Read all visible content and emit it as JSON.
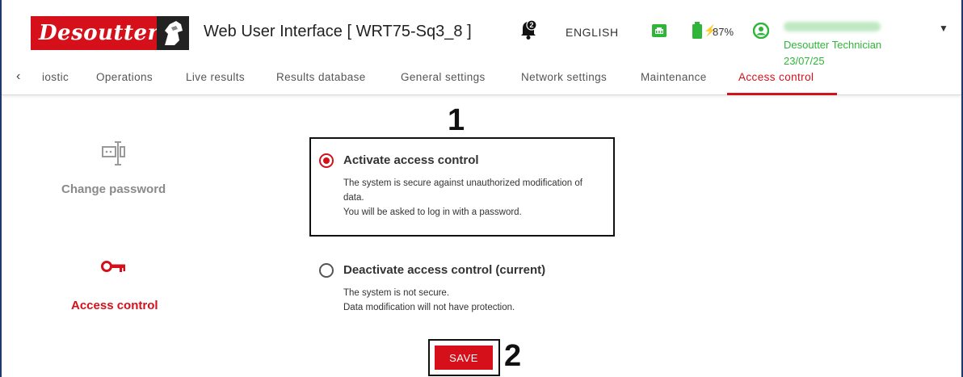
{
  "header": {
    "brand": "Desoutter",
    "app_title": "Web User Interface [ WRT75-Sq3_8 ]",
    "notification_count": "2",
    "language": "ENGLISH",
    "battery_percent": "87%",
    "user_role": "Desoutter Technician",
    "user_date": "23/07/25"
  },
  "tabs": [
    {
      "label": "iostic"
    },
    {
      "label": "Operations"
    },
    {
      "label": "Live results"
    },
    {
      "label": "Results database"
    },
    {
      "label": "General settings"
    },
    {
      "label": "Network settings"
    },
    {
      "label": "Maintenance"
    },
    {
      "label": "Access control",
      "active": true
    }
  ],
  "side_menu": {
    "change_password": "Change password",
    "access_control": "Access control"
  },
  "options": {
    "activate": {
      "title": "Activate access control",
      "desc_line1": "The system is secure against unauthorized modification of",
      "desc_line2": "data.",
      "desc_line3": "You will be asked to log in with a password.",
      "selected": true
    },
    "deactivate": {
      "title": "Deactivate access control (current)",
      "desc_line1": "The system is not secure.",
      "desc_line2": "Data modification will not have protection.",
      "selected": false
    }
  },
  "save_label": "SAVE",
  "annotations": {
    "first": "1",
    "second": "2"
  },
  "colors": {
    "brand_red": "#d6101b",
    "status_green": "#2fb53a"
  }
}
